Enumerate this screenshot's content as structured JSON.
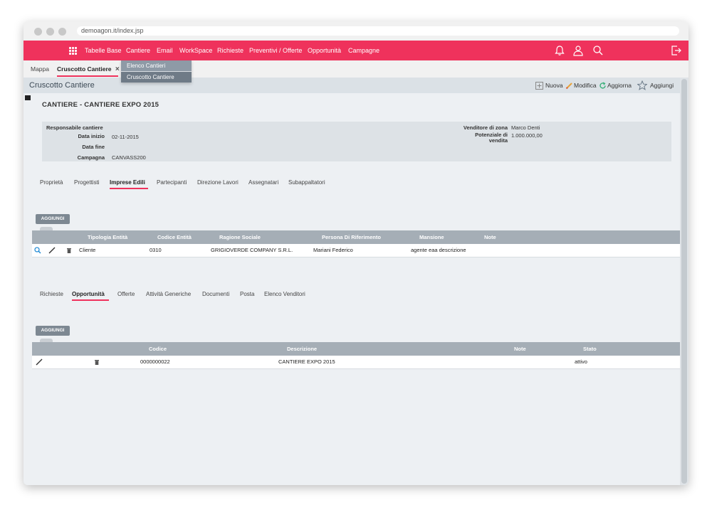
{
  "browser": {
    "url": "demoagon.it/index.jsp"
  },
  "topnav": {
    "items": [
      {
        "label": "Tabelle Base"
      },
      {
        "label": "Cantiere"
      },
      {
        "label": "Email"
      },
      {
        "label": "WorkSpace"
      },
      {
        "label": "Richieste"
      },
      {
        "label": "Preventivi / Offerte"
      },
      {
        "label": "Opportunità"
      },
      {
        "label": "Campagne"
      }
    ],
    "icons": [
      "grid-icon",
      "bell-icon",
      "user-icon",
      "search-icon",
      "logout-icon"
    ],
    "accent": "#ef325c"
  },
  "dropdown": {
    "items": [
      {
        "label": "Elenco Cantieri"
      },
      {
        "label": "Cruscotto Cantiere"
      }
    ]
  },
  "subtabs": {
    "items": [
      {
        "label": "Mappa"
      },
      {
        "label": "Cruscotto Cantiere"
      }
    ],
    "close": "×"
  },
  "page": {
    "title": "Cruscotto Cantiere",
    "toolbar": {
      "nuova": "Nuova",
      "modifica": "Modifica",
      "aggiorna": "Aggiorna",
      "aggiungi": "Aggiungi"
    }
  },
  "cantiere": {
    "title": "CANTIERE - CANTIERE EXPO 2015",
    "fields": {
      "responsabile_label": "Responsabile cantiere",
      "data_inizio_label": "Data inizio",
      "data_inizio": "02-11-2015",
      "data_fine_label": "Data fine",
      "campagna_label": "Campagna",
      "campagna": "CANVASS200",
      "venditore_label": "Venditore di zona",
      "venditore": "Marco Denti",
      "potenziale_label": "Potenziale di vendita",
      "potenziale": "1.000.000,00"
    }
  },
  "section1": {
    "tabs": [
      {
        "label": "Proprietà"
      },
      {
        "label": "Progettisti"
      },
      {
        "label": "Imprese Edili"
      },
      {
        "label": "Partecipanti"
      },
      {
        "label": "Direzione Lavori"
      },
      {
        "label": "Assegnatari"
      },
      {
        "label": "Subappaltatori"
      }
    ],
    "add_label": "AGGIUNGI",
    "columns": [
      "Tipologia Entità",
      "Codice Entità",
      "Ragione Sociale",
      "Persona Di Riferimento",
      "Mansione",
      "Note"
    ],
    "rows": [
      {
        "tipologia": "Cliente",
        "codice": "0310",
        "ragione": "GRIGIOVERDE COMPANY S.R.L.",
        "persona": "Mariani Federico",
        "mansione": "agente eaa descrizione",
        "note": ""
      }
    ]
  },
  "section2": {
    "tabs": [
      {
        "label": "Richieste"
      },
      {
        "label": "Opportunità"
      },
      {
        "label": "Offerte"
      },
      {
        "label": "Attività Generiche"
      },
      {
        "label": "Documenti"
      },
      {
        "label": "Posta"
      },
      {
        "label": "Elenco Venditori"
      }
    ],
    "add_label": "AGGIUNGI",
    "columns": [
      "Codice",
      "Descrizione",
      "Note",
      "Stato"
    ],
    "rows": [
      {
        "codice": "0000000022",
        "descrizione": "CANTIERE EXPO 2015",
        "note": "",
        "stato": "attivo"
      }
    ]
  }
}
